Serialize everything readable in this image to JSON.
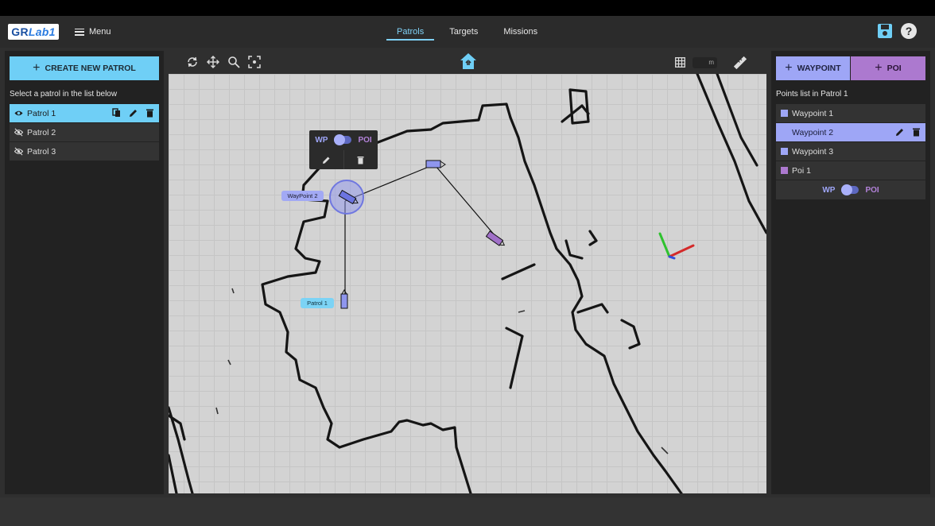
{
  "header": {
    "logo_left": "GR",
    "logo_right": "Lab1",
    "menu_label": "Menu",
    "tabs": [
      {
        "label": "Patrols",
        "active": true
      },
      {
        "label": "Targets",
        "active": false
      },
      {
        "label": "Missions",
        "active": false
      }
    ],
    "icons": {
      "save": "save-icon",
      "help": "help-icon"
    },
    "help_glyph": "?"
  },
  "left_panel": {
    "create_button": "CREATE NEW PATROL",
    "caption": "Select a patrol in the list below",
    "patrols": [
      {
        "label": "Patrol 1",
        "visible": true,
        "selected": true
      },
      {
        "label": "Patrol 2",
        "visible": false,
        "selected": false
      },
      {
        "label": "Patrol 3",
        "visible": false,
        "selected": false
      }
    ]
  },
  "toolbar": {
    "tools": [
      "rotate-icon",
      "move-icon",
      "zoom-icon",
      "focus-icon"
    ],
    "home_icon": "home-icon",
    "grid_icon": "grid-icon",
    "scale_unit": "m",
    "ruler_icon": "ruler-icon"
  },
  "map": {
    "popup": {
      "wp_label": "WP",
      "poi_label": "POI",
      "toggle_state": "WP"
    },
    "tags": {
      "waypoint2": "WayPoint 2",
      "patrol1": "Patrol 1"
    }
  },
  "right_panel": {
    "waypoint_button": "WAYPOINT",
    "poi_button": "POI",
    "caption": "Points list in Patrol 1",
    "points": [
      {
        "label": "Waypoint 1",
        "kind": "waypoint",
        "selected": false
      },
      {
        "label": "Waypoint 2",
        "kind": "waypoint",
        "selected": true
      },
      {
        "label": "Waypoint 3",
        "kind": "waypoint",
        "selected": false
      },
      {
        "label": "Poi 1",
        "kind": "poi",
        "selected": false
      }
    ],
    "toggle": {
      "wp_label": "WP",
      "poi_label": "POI"
    }
  },
  "colors": {
    "accent_patrol": "#6fcff6",
    "waypoint": "#9ea6f6",
    "poi": "#ac79cf",
    "map_bg": "#d3d3d3",
    "panel_bg": "#222222"
  }
}
